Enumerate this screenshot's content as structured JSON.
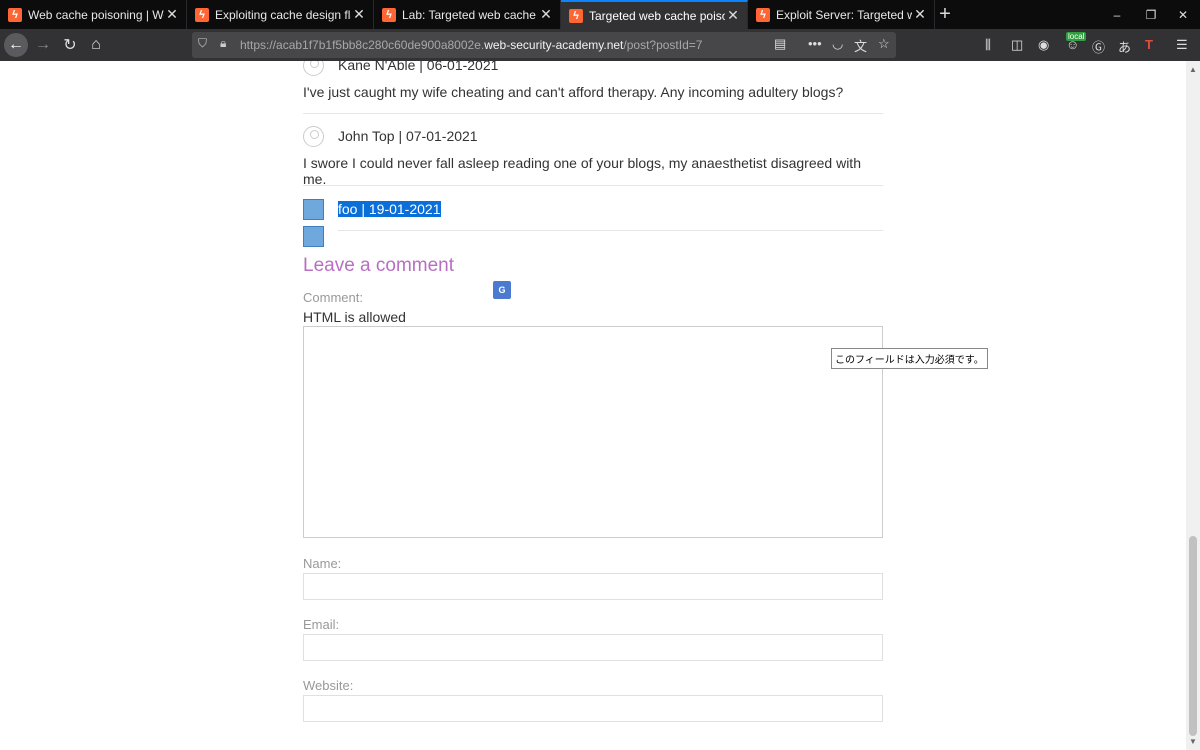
{
  "tabs": [
    {
      "title": "Web cache poisoning | Web Se",
      "active": false
    },
    {
      "title": "Exploiting cache design flaws |",
      "active": false
    },
    {
      "title": "Lab: Targeted web cache poiso",
      "active": false
    },
    {
      "title": "Targeted web cache poisoning",
      "active": true
    },
    {
      "title": "Exploit Server: Targeted web ca",
      "active": false
    }
  ],
  "window_controls": {
    "minimize": "–",
    "restore": "❐",
    "close": "✕"
  },
  "navbar": {
    "url_prefix": "https://acab1f7b1f5bb8c280c60de900a8002e.",
    "url_domain": "web-security-academy.net",
    "url_path": "/post?postId=7",
    "local_badge": "local"
  },
  "comments": [
    {
      "author": "Kane N'Able | 06-01-2021",
      "text": "I've just caught my wife cheating and can't afford therapy. Any incoming adultery blogs?"
    },
    {
      "author": "John Top | 07-01-2021",
      "text": "I swore I could never fall asleep reading one of your blogs, my anaesthetist disagreed with me."
    },
    {
      "author": "foo | 19-01-2021",
      "text": ""
    }
  ],
  "form": {
    "heading": "Leave a comment",
    "comment_label": "Comment:",
    "html_note": "HTML is allowed",
    "name_label": "Name:",
    "email_label": "Email:",
    "website_label": "Website:"
  },
  "tooltip": "このフィールドは入力必須です。",
  "colors": {
    "accent_tab": "#0a84ff",
    "heading": "#b86fc3",
    "selection": "#0a6fd8"
  }
}
